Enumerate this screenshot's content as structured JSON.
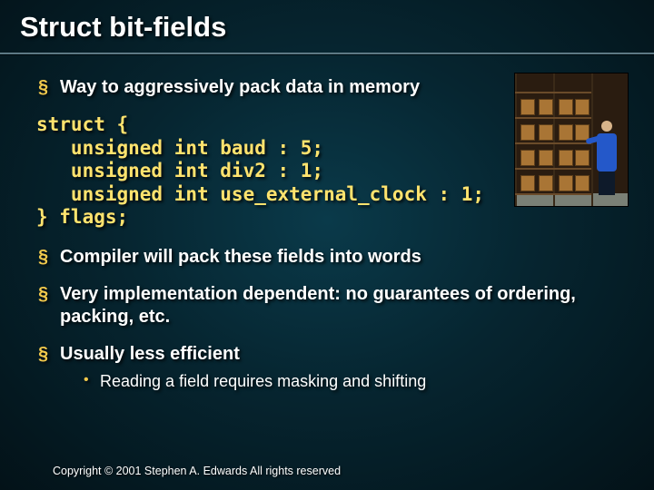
{
  "title": "Struct bit-fields",
  "bullets": {
    "b1": "Way to aggressively pack data in memory",
    "b2": "Compiler will pack these fields into words",
    "b3": "Very implementation dependent: no guarantees of ordering, packing, etc.",
    "b4": "Usually less efficient",
    "b4_sub": "Reading a field requires masking and shifting"
  },
  "code": "struct {\n   unsigned int baud : 5;\n   unsigned int div2 : 1;\n   unsigned int use_external_clock : 1;\n} flags;",
  "copyright": "Copyright © 2001 Stephen A. Edwards  All rights reserved",
  "image_alt": "warehouse-worker-with-boxes"
}
